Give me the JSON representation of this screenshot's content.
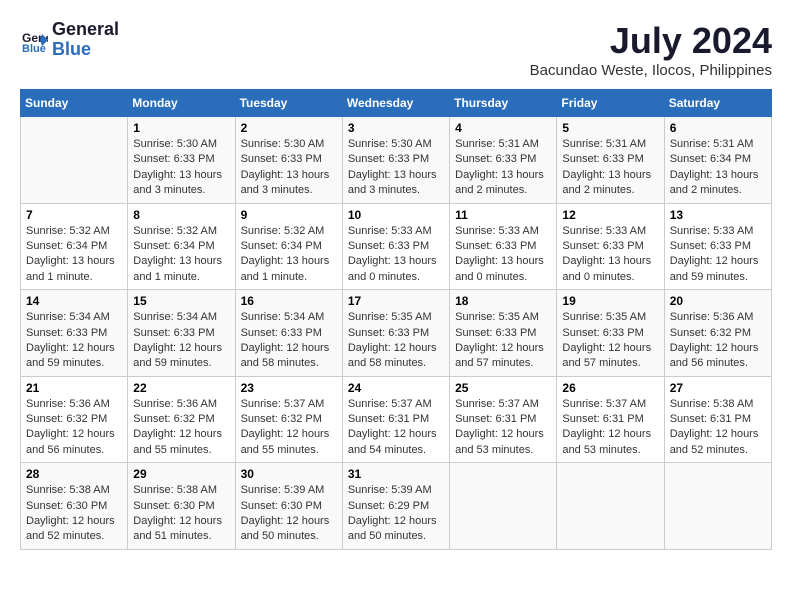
{
  "logo": {
    "line1": "General",
    "line2": "Blue"
  },
  "title": "July 2024",
  "subtitle": "Bacundao Weste, Ilocos, Philippines",
  "days_of_week": [
    "Sunday",
    "Monday",
    "Tuesday",
    "Wednesday",
    "Thursday",
    "Friday",
    "Saturday"
  ],
  "weeks": [
    [
      {
        "day": "",
        "info": ""
      },
      {
        "day": "1",
        "info": "Sunrise: 5:30 AM\nSunset: 6:33 PM\nDaylight: 13 hours\nand 3 minutes."
      },
      {
        "day": "2",
        "info": "Sunrise: 5:30 AM\nSunset: 6:33 PM\nDaylight: 13 hours\nand 3 minutes."
      },
      {
        "day": "3",
        "info": "Sunrise: 5:30 AM\nSunset: 6:33 PM\nDaylight: 13 hours\nand 3 minutes."
      },
      {
        "day": "4",
        "info": "Sunrise: 5:31 AM\nSunset: 6:33 PM\nDaylight: 13 hours\nand 2 minutes."
      },
      {
        "day": "5",
        "info": "Sunrise: 5:31 AM\nSunset: 6:33 PM\nDaylight: 13 hours\nand 2 minutes."
      },
      {
        "day": "6",
        "info": "Sunrise: 5:31 AM\nSunset: 6:34 PM\nDaylight: 13 hours\nand 2 minutes."
      }
    ],
    [
      {
        "day": "7",
        "info": "Sunrise: 5:32 AM\nSunset: 6:34 PM\nDaylight: 13 hours\nand 1 minute."
      },
      {
        "day": "8",
        "info": "Sunrise: 5:32 AM\nSunset: 6:34 PM\nDaylight: 13 hours\nand 1 minute."
      },
      {
        "day": "9",
        "info": "Sunrise: 5:32 AM\nSunset: 6:34 PM\nDaylight: 13 hours\nand 1 minute."
      },
      {
        "day": "10",
        "info": "Sunrise: 5:33 AM\nSunset: 6:33 PM\nDaylight: 13 hours\nand 0 minutes."
      },
      {
        "day": "11",
        "info": "Sunrise: 5:33 AM\nSunset: 6:33 PM\nDaylight: 13 hours\nand 0 minutes."
      },
      {
        "day": "12",
        "info": "Sunrise: 5:33 AM\nSunset: 6:33 PM\nDaylight: 13 hours\nand 0 minutes."
      },
      {
        "day": "13",
        "info": "Sunrise: 5:33 AM\nSunset: 6:33 PM\nDaylight: 12 hours\nand 59 minutes."
      }
    ],
    [
      {
        "day": "14",
        "info": "Sunrise: 5:34 AM\nSunset: 6:33 PM\nDaylight: 12 hours\nand 59 minutes."
      },
      {
        "day": "15",
        "info": "Sunrise: 5:34 AM\nSunset: 6:33 PM\nDaylight: 12 hours\nand 59 minutes."
      },
      {
        "day": "16",
        "info": "Sunrise: 5:34 AM\nSunset: 6:33 PM\nDaylight: 12 hours\nand 58 minutes."
      },
      {
        "day": "17",
        "info": "Sunrise: 5:35 AM\nSunset: 6:33 PM\nDaylight: 12 hours\nand 58 minutes."
      },
      {
        "day": "18",
        "info": "Sunrise: 5:35 AM\nSunset: 6:33 PM\nDaylight: 12 hours\nand 57 minutes."
      },
      {
        "day": "19",
        "info": "Sunrise: 5:35 AM\nSunset: 6:33 PM\nDaylight: 12 hours\nand 57 minutes."
      },
      {
        "day": "20",
        "info": "Sunrise: 5:36 AM\nSunset: 6:32 PM\nDaylight: 12 hours\nand 56 minutes."
      }
    ],
    [
      {
        "day": "21",
        "info": "Sunrise: 5:36 AM\nSunset: 6:32 PM\nDaylight: 12 hours\nand 56 minutes."
      },
      {
        "day": "22",
        "info": "Sunrise: 5:36 AM\nSunset: 6:32 PM\nDaylight: 12 hours\nand 55 minutes."
      },
      {
        "day": "23",
        "info": "Sunrise: 5:37 AM\nSunset: 6:32 PM\nDaylight: 12 hours\nand 55 minutes."
      },
      {
        "day": "24",
        "info": "Sunrise: 5:37 AM\nSunset: 6:31 PM\nDaylight: 12 hours\nand 54 minutes."
      },
      {
        "day": "25",
        "info": "Sunrise: 5:37 AM\nSunset: 6:31 PM\nDaylight: 12 hours\nand 53 minutes."
      },
      {
        "day": "26",
        "info": "Sunrise: 5:37 AM\nSunset: 6:31 PM\nDaylight: 12 hours\nand 53 minutes."
      },
      {
        "day": "27",
        "info": "Sunrise: 5:38 AM\nSunset: 6:31 PM\nDaylight: 12 hours\nand 52 minutes."
      }
    ],
    [
      {
        "day": "28",
        "info": "Sunrise: 5:38 AM\nSunset: 6:30 PM\nDaylight: 12 hours\nand 52 minutes."
      },
      {
        "day": "29",
        "info": "Sunrise: 5:38 AM\nSunset: 6:30 PM\nDaylight: 12 hours\nand 51 minutes."
      },
      {
        "day": "30",
        "info": "Sunrise: 5:39 AM\nSunset: 6:30 PM\nDaylight: 12 hours\nand 50 minutes."
      },
      {
        "day": "31",
        "info": "Sunrise: 5:39 AM\nSunset: 6:29 PM\nDaylight: 12 hours\nand 50 minutes."
      },
      {
        "day": "",
        "info": ""
      },
      {
        "day": "",
        "info": ""
      },
      {
        "day": "",
        "info": ""
      }
    ]
  ]
}
